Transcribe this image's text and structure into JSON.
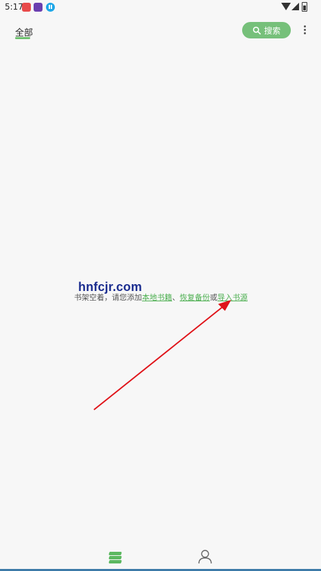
{
  "status_bar": {
    "time": "5:17"
  },
  "header": {
    "tab_label": "全部",
    "search_label": "搜索",
    "accent_color": "#76c07a"
  },
  "watermark": "hnfcjr.com",
  "empty_state": {
    "prefix": "书架空着，请您添加",
    "link_local": "本地书籍",
    "sep1": "、",
    "link_restore": "恢复备份",
    "sep2": "或",
    "link_import": "导入书源"
  },
  "bottom_nav": {
    "items": [
      "bookshelf-icon",
      "profile-icon"
    ]
  },
  "annotation": {
    "arrow_color": "#e0141a"
  }
}
